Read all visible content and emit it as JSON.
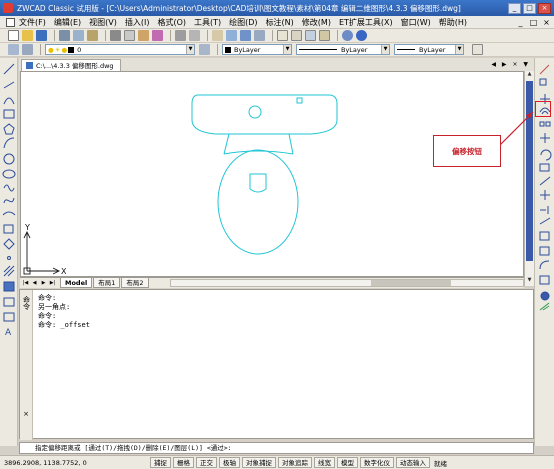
{
  "window": {
    "title": "ZWCAD Classic 试用版 - [C:\\Users\\Administrator\\Desktop\\CAD培训\\图文教程\\素材\\第04章 编辑二维图形\\4.3.3 偏移图形.dwg]",
    "minimize": "_",
    "maximize": "□",
    "close": "×"
  },
  "menu": {
    "items": [
      "文件(F)",
      "编辑(E)",
      "视图(V)",
      "插入(I)",
      "格式(O)",
      "工具(T)",
      "绘图(D)",
      "标注(N)",
      "修改(M)",
      "ET扩展工具(X)",
      "窗口(W)",
      "帮助(H)"
    ],
    "controls": [
      "_",
      "□",
      "×"
    ]
  },
  "props": {
    "layer": "0",
    "color": "ByLayer",
    "linetype": "ByLayer",
    "lineweight": "ByLayer"
  },
  "doc": {
    "tab": "C:\\...\\4.3.3 偏移图形.dwg",
    "nav": "◀ ▶ × ▼"
  },
  "axes": {
    "x": "X",
    "y": "Y"
  },
  "layout": {
    "tabs": [
      "Model",
      "布局1",
      "布局2"
    ]
  },
  "command": {
    "label": "命令",
    "close": "×",
    "history": [
      "命令:",
      "另一角点:",
      "命令:",
      "命令: _offset"
    ],
    "prompt": "指定偏移距离或 [通过(T)/拖拽(D)/删除(E)/图层(L)] <通过>:"
  },
  "status": {
    "coords": "3896.2908,  1138.7752,  0",
    "buttons": [
      "捕捉",
      "栅格",
      "正交",
      "极轴",
      "对象捕捉",
      "对象追踪",
      "线宽",
      "模型",
      "数字化仪",
      "动态输入",
      "就绪"
    ]
  },
  "annotation": {
    "callout": "偏移按钮"
  },
  "colors": {
    "drawing": "#22c6d6",
    "accent": "#3a59a9",
    "callout": "#c8232c"
  }
}
